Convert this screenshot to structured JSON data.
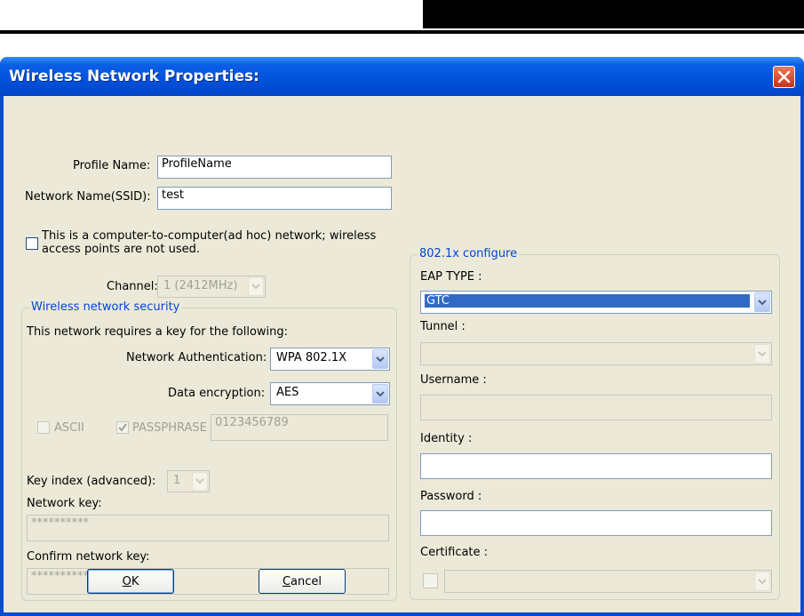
{
  "window": {
    "title": "Wireless Network Properties:"
  },
  "profile": {
    "label": "Profile Name:",
    "value": "ProfileName"
  },
  "ssid": {
    "label": "Network Name(SSID):",
    "value": "test"
  },
  "adhoc": {
    "label_line1": "This is a computer-to-computer(ad hoc) network; wireless",
    "label_line2": "access points are not used.",
    "checked": false
  },
  "channel": {
    "label": "Channel:",
    "value": "1  (2412MHz)"
  },
  "security": {
    "group_title": "Wireless network security",
    "requires_text": "This network requires a key for the following:",
    "auth_label": "Network Authentication:",
    "auth_value": "WPA 802.1X",
    "enc_label": "Data encryption:",
    "enc_value": "AES",
    "ascii_label": "ASCII",
    "passphrase_label": "PASSPHRASE",
    "passphrase_value": "0123456789",
    "key_index_label": "Key index (advanced):",
    "key_index_value": "1",
    "network_key_label": "Network key:",
    "network_key_value": "**********",
    "confirm_key_label": "Confirm network key:",
    "confirm_key_value": "**********"
  },
  "dot1x": {
    "group_title": "802.1x configure",
    "eap_label": "EAP TYPE :",
    "eap_value": "GTC",
    "tunnel_label": "Tunnel :",
    "tunnel_value": "",
    "username_label": "Username :",
    "username_value": "",
    "identity_label": "Identity :",
    "identity_value": "",
    "password_label": "Password :",
    "password_value": "",
    "certificate_label": "Certificate :",
    "certificate_value": ""
  },
  "buttons": {
    "ok_prefix": "",
    "ok_mnemonic": "O",
    "ok_rest": "K",
    "cancel_mnemonic": "C",
    "cancel_rest": "ancel"
  },
  "colors": {
    "titlebar": "#0051db",
    "client_bg": "#ece9d8",
    "group_title": "#0046d5",
    "selection": "#316ac5",
    "close": "#c83214"
  }
}
